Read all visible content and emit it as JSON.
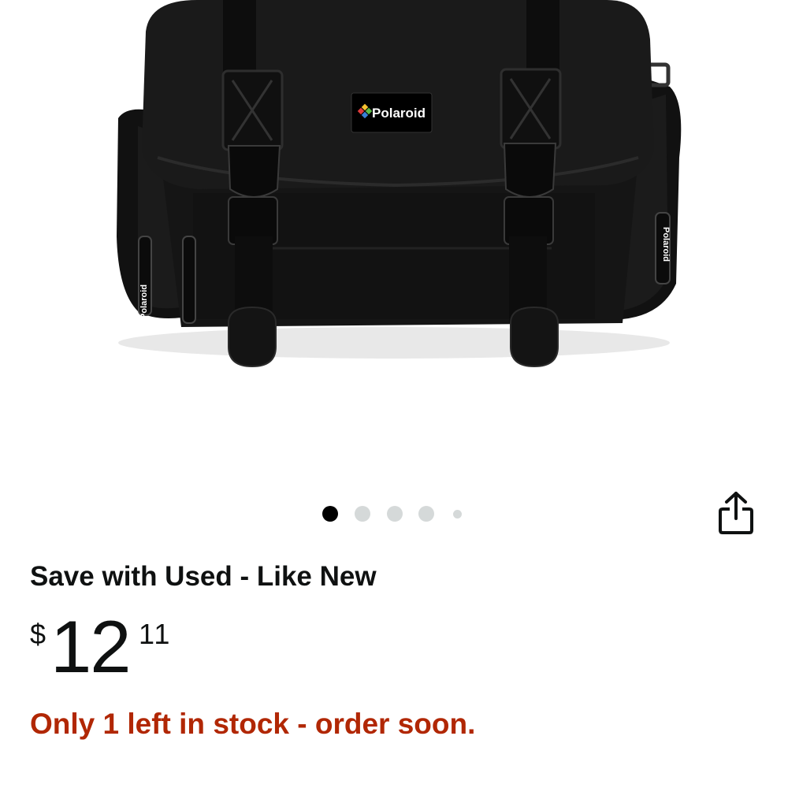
{
  "product_image": {
    "brand_label": "Polaroid",
    "zipper_brand": "Polaroid",
    "alt": "product-photo"
  },
  "carousel": {
    "count": 5,
    "active_index": 0
  },
  "share": {
    "icon": "share-icon"
  },
  "deal": {
    "title": "Save with Used - Like New"
  },
  "price": {
    "symbol": "$",
    "whole": "12",
    "fraction": "11"
  },
  "stock": {
    "message": "Only 1 left in stock - order soon."
  },
  "colors": {
    "accent_stock": "#b12704",
    "dot_active": "#000000",
    "dot_inactive": "#d5d9d9"
  }
}
